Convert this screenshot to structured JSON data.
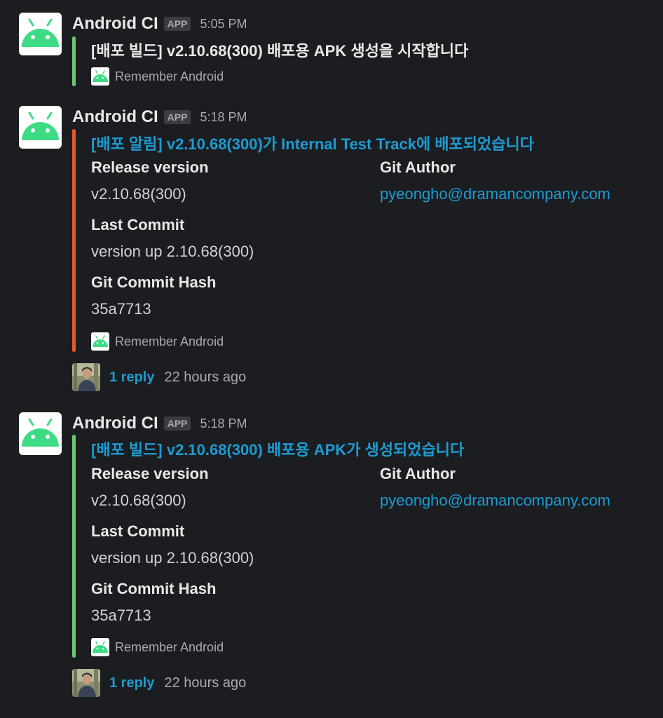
{
  "messages": [
    {
      "sender": "Android CI",
      "badge": "APP",
      "time": "5:05 PM",
      "title": "[배포 빌드] v2.10.68(300) 배포용 APK 생성을 시작합니다",
      "footer": "Remember Android"
    },
    {
      "sender": "Android CI",
      "badge": "APP",
      "time": "5:18 PM",
      "title": "[배포 알림] v2.10.68(300)가 Internal Test Track에 배포되었습니다",
      "fields": {
        "release_version_label": "Release version",
        "release_version_value": "v2.10.68(300)",
        "git_author_label": "Git Author",
        "git_author_value": "pyeongho@dramancompany.com",
        "last_commit_label": "Last Commit",
        "last_commit_value": "version up 2.10.68(300)",
        "commit_hash_label": "Git Commit Hash",
        "commit_hash_value": "35a7713"
      },
      "footer": "Remember Android",
      "thread": {
        "reply_count": "1 reply",
        "reply_time": "22 hours ago"
      }
    },
    {
      "sender": "Android CI",
      "badge": "APP",
      "time": "5:18 PM",
      "title": "[배포 빌드] v2.10.68(300) 배포용 APK가 생성되었습니다",
      "fields": {
        "release_version_label": "Release version",
        "release_version_value": "v2.10.68(300)",
        "git_author_label": "Git Author",
        "git_author_value": "pyeongho@dramancompany.com",
        "last_commit_label": "Last Commit",
        "last_commit_value": "version up 2.10.68(300)",
        "commit_hash_label": "Git Commit Hash",
        "commit_hash_value": "35a7713"
      },
      "footer": "Remember Android",
      "thread": {
        "reply_count": "1 reply",
        "reply_time": "22 hours ago"
      }
    }
  ],
  "colors": {
    "background": "#1b1d21",
    "android_green": "#3ddc84",
    "bar_green": "#6cc775",
    "bar_orange": "#e5582b",
    "link": "#1d9bd1"
  },
  "icons": {
    "bot_avatar": "android-robot-icon",
    "footer_icon": "android-robot-icon",
    "reply_avatar": "user-photo-avatar"
  }
}
